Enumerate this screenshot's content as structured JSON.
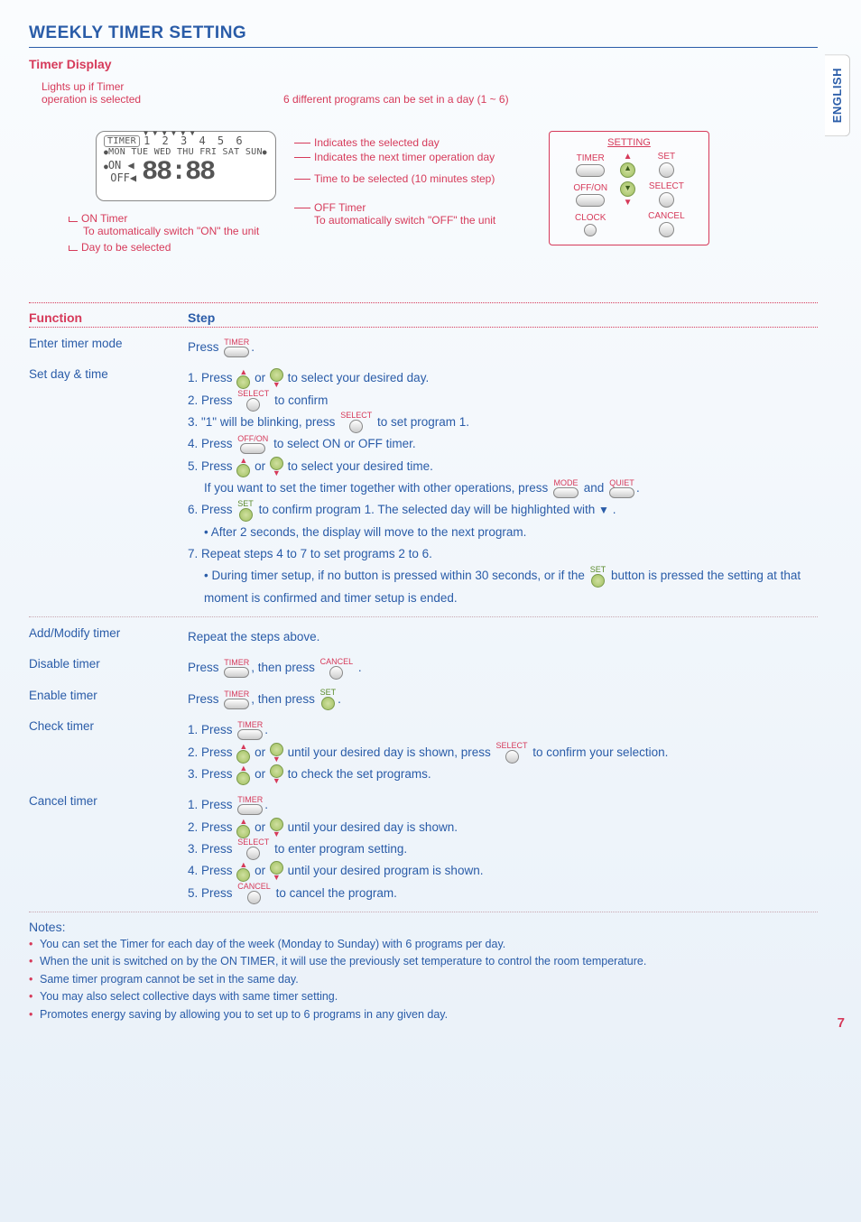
{
  "side_tab": "ENGLISH",
  "page_number": "7",
  "heading": "WEEKLY TIMER SETTING",
  "subheading": "Timer Display",
  "diagram": {
    "ann_lights": "Lights up if Timer\noperation is selected",
    "ann_6programs": "6 different programs can be set in a day (1 ~ 6)",
    "ann_sel_day": "Indicates the selected day",
    "ann_next_day": "Indicates the next timer operation day",
    "ann_time": "Time to be selected (10 minutes step)",
    "ann_off": "OFF Timer",
    "ann_off2": "To automatically switch \"OFF\" the unit",
    "ann_on": "ON Timer",
    "ann_on2": "To automatically switch \"ON\" the unit",
    "ann_day": "Day to be selected",
    "lcd": {
      "label_timer": "TIMER",
      "programs": "1 2 3 4 5 6",
      "days": "MON TUE WED THU FRI SAT SUN",
      "on": "ON",
      "off": "OFF",
      "digits": "88:88"
    },
    "remote": {
      "title": "SETTING",
      "labels": {
        "timer": "TIMER",
        "up": "",
        "set": "SET",
        "offon": "OFF/ON",
        "down": "",
        "select": "SELECT",
        "clock": "CLOCK",
        "cancel": "CANCEL"
      }
    }
  },
  "table": {
    "head_function": "Function",
    "head_step": "Step",
    "rows": {
      "enter": {
        "label": "Enter timer mode",
        "step": {
          "press": "Press",
          "timer": "TIMER",
          "dot": "."
        }
      },
      "setday": {
        "label": "Set day & time",
        "s1a": "1. Press",
        "s1b": "or",
        "s1c": "to select your desired day.",
        "s2a": "2.  Press",
        "s2lbl": "SELECT",
        "s2b": "to confirm",
        "s3a": "3.  \"1\" will be blinking, press",
        "s3lbl": "SELECT",
        "s3b": "to set program 1.",
        "s4a": "4. Press",
        "s4lbl": "OFF/ON",
        "s4b": "to select ON or OFF timer.",
        "s5a": "5. Press",
        "s5b": "or",
        "s5c": "to select your desired time.",
        "s5d": "If you want to set the timer together with other operations, press",
        "s5mode": "MODE",
        "s5and": "and",
        "s5quiet": "QUIET",
        "s5dot": ".",
        "s6a": "6. Press",
        "s6lbl": "SET",
        "s6b": "to confirm program 1. The selected day will be highlighted with",
        "s6tri": "▼",
        "s6dot": ".",
        "s6sub": "• After 2 seconds, the display will move to the next program.",
        "s7": "7. Repeat steps 4 to 7 to set programs 2 to 6.",
        "s7suba": "• During timer setup, if no button is pressed within 30 seconds, or if the",
        "s7lbl": "SET",
        "s7subb": "button is pressed the setting at that moment is confirmed and timer setup is ended."
      },
      "addmod": {
        "label": "Add/Modify timer",
        "step": "Repeat the steps above."
      },
      "disable": {
        "label": "Disable timer",
        "a": "Press",
        "timer": "TIMER",
        "b": ", then press",
        "cancel": "CANCEL",
        "dot": "."
      },
      "enable": {
        "label": "Enable timer",
        "a": "Press",
        "timer": "TIMER",
        "b": ", then press",
        "set": "SET",
        "dot": "."
      },
      "check": {
        "label": "Check timer",
        "s1a": "1. Press",
        "s1lbl": "TIMER",
        "s1dot": ".",
        "s2a": "2. Press",
        "s2b": "or",
        "s2c": "until your desired day is shown, press",
        "s2lbl": "SELECT",
        "s2d": "to confirm your selection.",
        "s3a": "3. Press",
        "s3b": "or",
        "s3c": "to check the set programs."
      },
      "cancel": {
        "label": "Cancel timer",
        "s1a": "1. Press",
        "s1lbl": "TIMER",
        "s1dot": ".",
        "s2a": "2. Press",
        "s2b": "or",
        "s2c": "until your desired day is shown.",
        "s3a": "3.  Press",
        "s3lbl": "SELECT",
        "s3b": "to enter program setting.",
        "s4a": "4. Press",
        "s4b": "or",
        "s4c": "until your desired program is shown.",
        "s5a": "5.  Press",
        "s5lbl": "CANCEL",
        "s5b": "to cancel the program."
      }
    }
  },
  "notes_head": "Notes:",
  "notes": [
    "You can set the Timer for each day of the week (Monday to Sunday) with 6 programs per day.",
    "When the unit is switched on by the ON TIMER, it will use the previously set temperature to control the room temperature.",
    "Same timer program cannot be set in the same day.",
    "You may also select collective days with same timer setting.",
    "Promotes energy saving by allowing you to set up to 6 programs in any given day."
  ]
}
